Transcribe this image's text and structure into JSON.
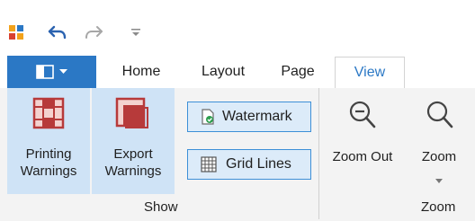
{
  "qat": {
    "app_icon": "app-window-icon",
    "undo_icon": "undo-icon",
    "redo_icon": "redo-icon",
    "customize_icon": "customize-dropdown-icon"
  },
  "tabs": {
    "file_icon": "file-menu-icon",
    "items": [
      {
        "label": "Home"
      },
      {
        "label": "Layout"
      },
      {
        "label": "Page"
      },
      {
        "label": "View"
      }
    ],
    "active": "View"
  },
  "ribbon": {
    "show_group": {
      "label": "Show",
      "printing_warnings": {
        "line1": "Printing",
        "line2": "Warnings"
      },
      "export_warnings": {
        "line1": "Export",
        "line2": "Warnings"
      },
      "watermark": "Watermark",
      "grid_lines": "Grid Lines"
    },
    "zoom_group": {
      "label": "Zoom",
      "zoom_out": "Zoom Out",
      "zoom": "Zoom"
    }
  },
  "colors": {
    "accent": "#2b78c5",
    "highlight": "#cfe3f6",
    "red_icon": "#b73a3a"
  }
}
